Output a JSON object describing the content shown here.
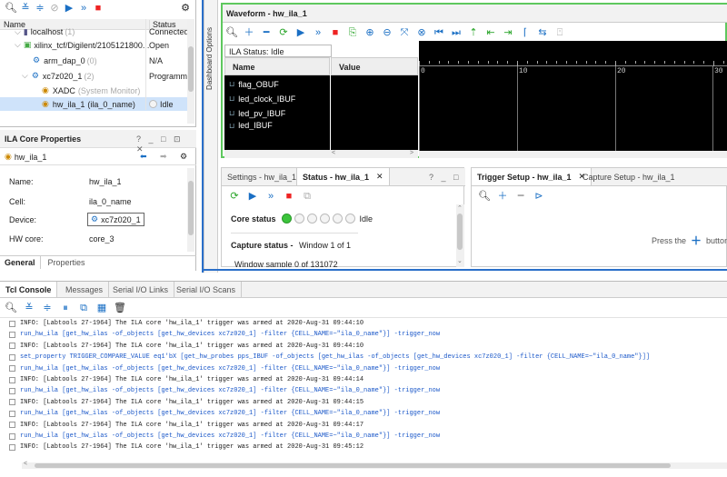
{
  "hw_tree": {
    "cols": {
      "name": "Name",
      "status": "Status"
    },
    "rows": [
      {
        "label": "localhost",
        "sub": "(1)",
        "status": "Connected"
      },
      {
        "label": "xilinx_tcf/Digilent/2105121800...",
        "sub": "",
        "status": "Open"
      },
      {
        "label": "arm_dap_0",
        "sub": "(0)",
        "status": "N/A"
      },
      {
        "label": "xc7z020_1",
        "sub": "(2)",
        "status": "Programme"
      },
      {
        "label": "XADC",
        "sub": "(System Monitor)",
        "status": ""
      },
      {
        "label": "hw_ila_1",
        "sub": "(ila_0_name)",
        "status": "Idle"
      }
    ]
  },
  "props": {
    "title": "ILA Core Properties",
    "header_buttons": "? _ □ ⊡ ✕",
    "object": "hw_ila_1",
    "fields": [
      {
        "k": "Name:",
        "v": "hw_ila_1"
      },
      {
        "k": "Cell:",
        "v": "ila_0_name"
      },
      {
        "k": "Device:",
        "v": "xc7z020_1"
      },
      {
        "k": "HW core:",
        "v": "core_3"
      }
    ],
    "tabs": [
      "General",
      "Properties"
    ]
  },
  "dashboard_label": "Dashboard Options",
  "waveform": {
    "title": "Waveform - hw_ila_1",
    "ila_status": "ILA Status: Idle",
    "cols": {
      "name": "Name",
      "value": "Value"
    },
    "signals": [
      "flag_OBUF",
      "led_clock_IBUF",
      "led_pv_IBUF",
      "led_IBUF"
    ],
    "ticks": [
      "0",
      "10",
      "20",
      "30"
    ]
  },
  "status_panel": {
    "tabs": [
      "Settings - hw_ila_1",
      "Status - hw_ila_1"
    ],
    "header_buttons": "? _ □",
    "core_status_label": "Core status",
    "core_status_value": "Idle",
    "capture_label": "Capture status -",
    "capture_value": "Window 1 of 1",
    "window_sample": "Window sample 0 of 131072"
  },
  "trigger_panel": {
    "tabs": [
      "Trigger Setup - hw_ila_1",
      "Capture Setup - hw_ila_1"
    ],
    "press_text": "Press the",
    "button_text": "button to"
  },
  "tcl": {
    "tabs": [
      "Tcl Console",
      "Messages",
      "Serial I/O Links",
      "Serial I/O Scans"
    ],
    "lines": [
      {
        "type": "info",
        "text": "INFO: [Labtools 27-1964] The ILA core 'hw_ila_1' trigger was armed at 2020-Aug-31 09:44:10"
      },
      {
        "type": "cmd",
        "text": "run_hw_ila [get_hw_ilas -of_objects [get_hw_devices xc7z020_1] -filter {CELL_NAME=~\"ila_0_name\"}] -trigger_now"
      },
      {
        "type": "info",
        "text": "INFO: [Labtools 27-1964] The ILA core 'hw_ila_1' trigger was armed at 2020-Aug-31 09:44:10"
      },
      {
        "type": "cmd",
        "text": "set_property TRIGGER_COMPARE_VALUE eq1'bX [get_hw_probes pps_IBUF -of_objects [get_hw_ilas -of_objects [get_hw_devices xc7z020_1] -filter {CELL_NAME=~\"ila_0_name\"}]]"
      },
      {
        "type": "cmd",
        "text": "run_hw_ila [get_hw_ilas -of_objects [get_hw_devices xc7z020_1] -filter {CELL_NAME=~\"ila_0_name\"}] -trigger_now"
      },
      {
        "type": "info",
        "text": "INFO: [Labtools 27-1964] The ILA core 'hw_ila_1' trigger was armed at 2020-Aug-31 09:44:14"
      },
      {
        "type": "cmd",
        "text": "run_hw_ila [get_hw_ilas -of_objects [get_hw_devices xc7z020_1] -filter {CELL_NAME=~\"ila_0_name\"}] -trigger_now"
      },
      {
        "type": "info",
        "text": "INFO: [Labtools 27-1964] The ILA core 'hw_ila_1' trigger was armed at 2020-Aug-31 09:44:15"
      },
      {
        "type": "cmd",
        "text": "run_hw_ila [get_hw_ilas -of_objects [get_hw_devices xc7z020_1] -filter {CELL_NAME=~\"ila_0_name\"}] -trigger_now"
      },
      {
        "type": "info",
        "text": "INFO: [Labtools 27-1964] The ILA core 'hw_ila_1' trigger was armed at 2020-Aug-31 09:44:17"
      },
      {
        "type": "cmd",
        "text": "run_hw_ila [get_hw_ilas -of_objects [get_hw_devices xc7z020_1] -filter {CELL_NAME=~\"ila_0_name\"}] -trigger_now"
      },
      {
        "type": "info",
        "text": "INFO: [Labtools 27-1964] The ILA core 'hw_ila_1' trigger was armed at 2020-Aug-31 09:45:12"
      }
    ]
  }
}
